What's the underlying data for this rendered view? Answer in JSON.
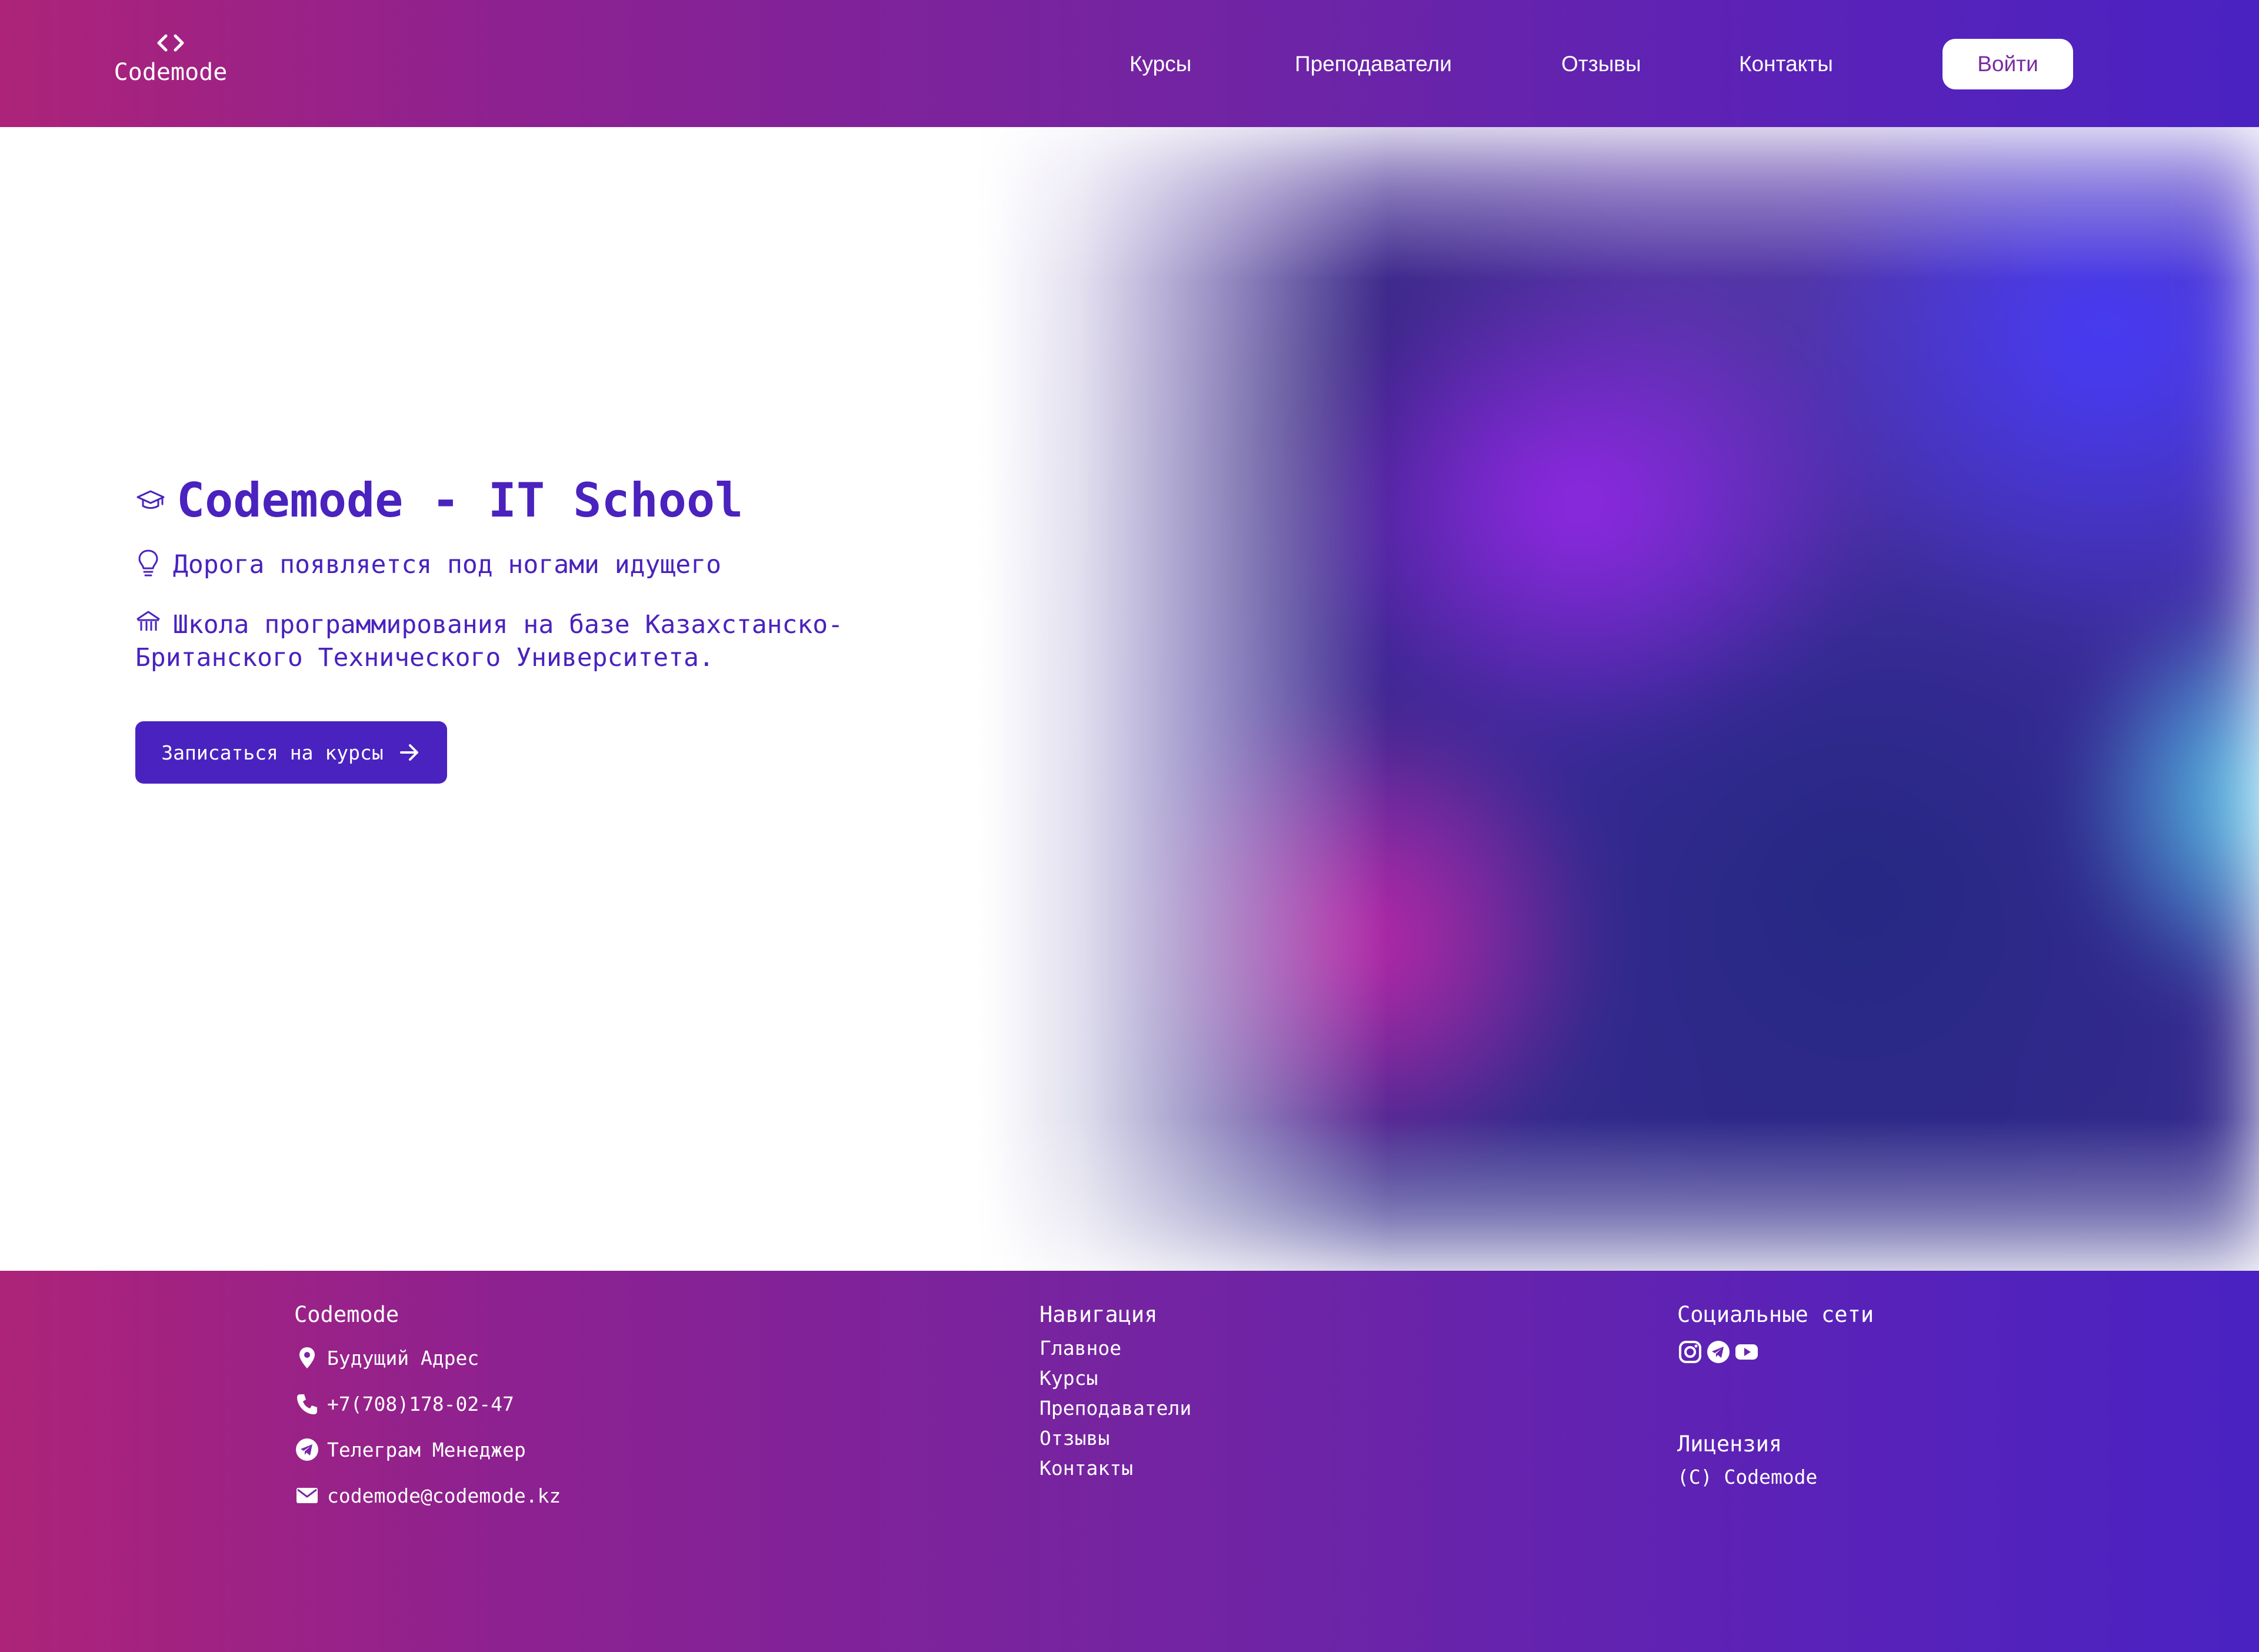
{
  "header": {
    "logo_text": "Codemode",
    "logo_icon": "code-brackets-icon",
    "nav": [
      {
        "label": "Курсы"
      },
      {
        "label": "Преподаватели"
      },
      {
        "label": "Отзывы"
      },
      {
        "label": "Контакты"
      }
    ],
    "login_label": "Войти"
  },
  "hero": {
    "title": "Codemode - IT School",
    "title_icon": "graduation-cap-icon",
    "motto": "Дорога появляется под ногами идущего",
    "motto_icon": "lightbulb-icon",
    "description": "Школа программирования на базе Казахстанско-Британского Технического Университета.",
    "description_icon": "university-building-icon",
    "cta_label": "Записаться на курсы",
    "cta_icon": "arrow-right-icon"
  },
  "footer": {
    "brand_heading": "Codemode",
    "contacts": [
      {
        "icon": "location-pin-icon",
        "text": "Будущий Адрес"
      },
      {
        "icon": "phone-icon",
        "text": "+7(708)178-02-47"
      },
      {
        "icon": "telegram-icon",
        "text": "Телеграм Менеджер"
      },
      {
        "icon": "mail-icon",
        "text": "codemode@codemode.kz"
      }
    ],
    "nav_heading": "Навигация",
    "nav_links": [
      {
        "label": "Главное"
      },
      {
        "label": "Курсы"
      },
      {
        "label": "Преподаватели"
      },
      {
        "label": "Отзывы"
      },
      {
        "label": "Контакты"
      }
    ],
    "social_heading": "Социальные сети",
    "socials": [
      "instagram-icon",
      "telegram-icon",
      "youtube-icon"
    ],
    "license_heading": "Лицензия",
    "license_text": "(C) Codemode"
  },
  "colors": {
    "brand_purple": "#4a22be",
    "gradient_start": "#ad2379",
    "gradient_end": "#4a22c2",
    "login_text": "#7a2aa0",
    "white": "#ffffff"
  }
}
